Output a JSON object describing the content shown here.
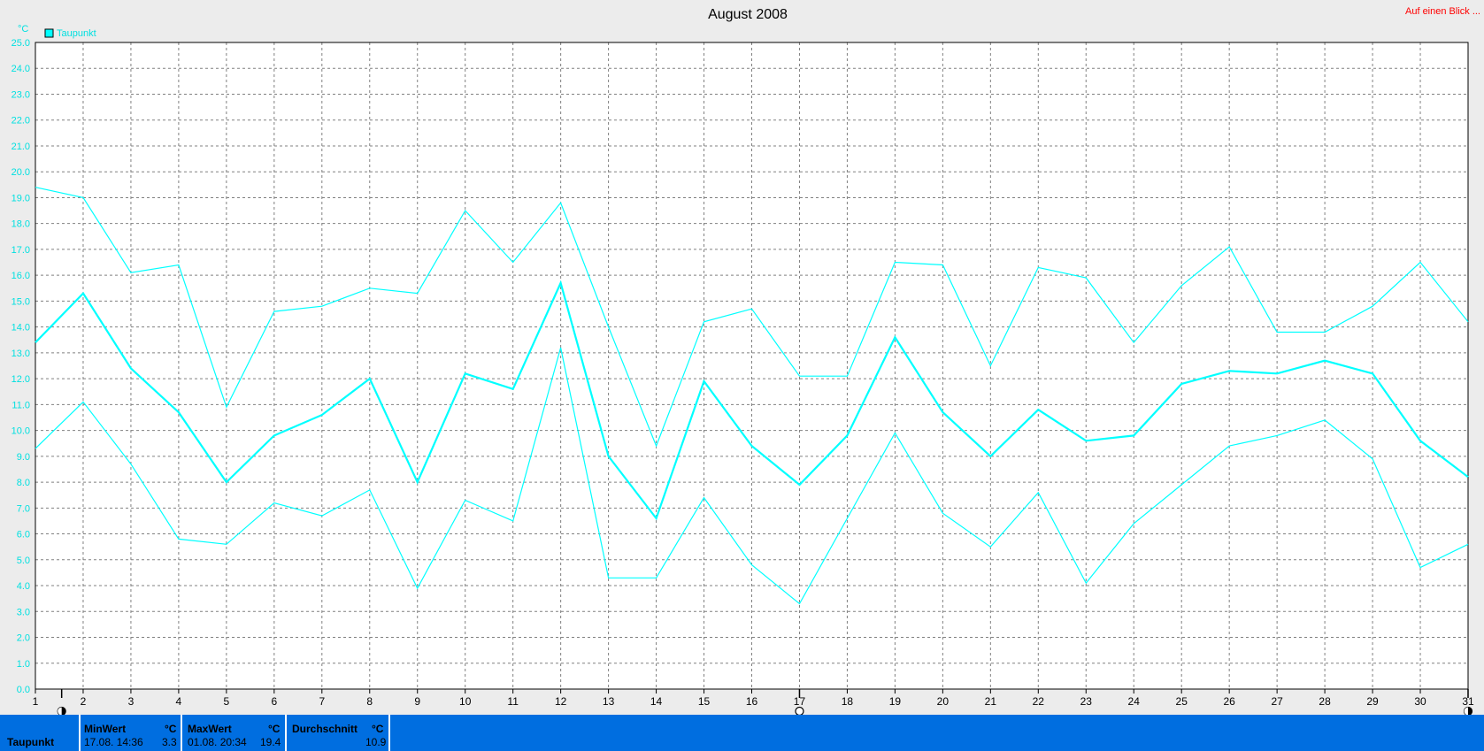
{
  "header": {
    "title": "August 2008",
    "top_right_link": "Auf einen Blick ..."
  },
  "colors": {
    "series": "#00ffff",
    "axis_text": "#00e0e0",
    "grid": "#808080",
    "stats_bg": "#006ee0",
    "link": "#ff0000"
  },
  "chart_data": {
    "type": "line",
    "title": "August 2008",
    "ylabel": "°C",
    "ylim": [
      0,
      25
    ],
    "yticks": [
      "0.0",
      "1.0",
      "2.0",
      "3.0",
      "4.0",
      "5.0",
      "6.0",
      "7.0",
      "8.0",
      "9.0",
      "10.0",
      "11.0",
      "12.0",
      "13.0",
      "14.0",
      "15.0",
      "16.0",
      "17.0",
      "18.0",
      "19.0",
      "20.0",
      "21.0",
      "22.0",
      "23.0",
      "24.0",
      "25.0"
    ],
    "x": [
      1,
      2,
      3,
      4,
      5,
      6,
      7,
      8,
      9,
      10,
      11,
      12,
      13,
      14,
      15,
      16,
      17,
      18,
      19,
      20,
      21,
      22,
      23,
      24,
      25,
      26,
      27,
      28,
      29,
      30,
      31
    ],
    "legend": [
      "Taupunkt"
    ],
    "legend_position": "top-left",
    "grid": true,
    "series": [
      {
        "role": "max",
        "values": [
          19.4,
          19.0,
          16.1,
          16.4,
          10.9,
          14.6,
          14.8,
          15.5,
          15.3,
          18.5,
          16.5,
          18.8,
          14.0,
          9.4,
          14.2,
          14.7,
          12.1,
          12.1,
          16.5,
          16.4,
          12.5,
          16.3,
          15.9,
          13.4,
          15.6,
          17.1,
          13.8,
          13.8,
          14.8,
          16.5,
          14.2
        ]
      },
      {
        "role": "avg",
        "values": [
          13.4,
          15.3,
          12.4,
          10.7,
          8.0,
          9.8,
          10.6,
          12.0,
          8.0,
          12.2,
          11.6,
          15.7,
          9.0,
          6.6,
          11.9,
          9.4,
          7.9,
          9.8,
          13.6,
          10.7,
          9.0,
          10.8,
          9.6,
          9.8,
          11.8,
          12.3,
          12.2,
          12.7,
          12.2,
          9.6,
          8.2
        ]
      },
      {
        "role": "min",
        "values": [
          9.3,
          11.1,
          8.7,
          5.8,
          5.6,
          7.2,
          6.7,
          7.7,
          3.9,
          7.3,
          6.5,
          13.2,
          4.3,
          4.3,
          7.4,
          4.8,
          3.3,
          6.6,
          9.9,
          6.8,
          5.5,
          7.6,
          4.1,
          6.4,
          7.9,
          9.4,
          9.8,
          10.4,
          8.9,
          4.7,
          5.6
        ]
      }
    ]
  },
  "stats": {
    "row_label": "Taupunkt",
    "min": {
      "label": "MinWert",
      "unit": "°C",
      "when": "17.08. 14:36",
      "value": "3.3"
    },
    "max": {
      "label": "MaxWert",
      "unit": "°C",
      "when": "01.08. 20:34",
      "value": "19.4"
    },
    "avg": {
      "label": "Durchschnitt",
      "unit": "°C",
      "value": "10.9"
    }
  }
}
